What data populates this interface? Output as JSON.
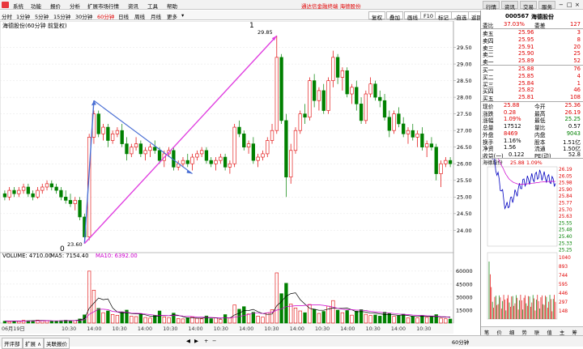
{
  "menubar": {
    "items": [
      "系统",
      "功能",
      "报价",
      "分析",
      "扩展市场行情",
      "资讯",
      "工具",
      "帮助"
    ],
    "notice": "通达信金融终端   海德股份",
    "right_buttons": [
      "行情",
      "资讯",
      "交易",
      "服务"
    ]
  },
  "periodbar": {
    "items": [
      "分时",
      "1分钟",
      "5分钟",
      "15分钟",
      "30分钟",
      "60分钟",
      "日线",
      "周线",
      "月线",
      "更多"
    ],
    "active_index": 5,
    "right_buttons": [
      "复权",
      "叠加",
      "画线",
      "F10",
      "标记",
      "-自选",
      "返回"
    ]
  },
  "chart": {
    "title": "海德股份(60分钟 前复权)",
    "volume_label": "VOLUME: 4710.00",
    "ma5_label": "MA5: 7154.40",
    "ma10_label": "MA10: 6392.00",
    "period_tag": "60分钟",
    "date_labels": [
      "06月19日",
      "10:30",
      "14:00",
      "10:30",
      "14:00",
      "10:30",
      "14:00",
      "10:30",
      "14:00",
      "10:30",
      "14:00",
      "10:30",
      "14:00",
      "10:30",
      "14:00",
      "10:30"
    ],
    "annotation_zero": "0",
    "annotation_one": "1",
    "low_price_label": "23.60",
    "high_price_label": "29.85",
    "colors": {
      "up": "#e00000",
      "down": "#008000",
      "ma5": "#000000",
      "ma10": "#cc00cc",
      "blue_line": "#4a6fd4",
      "pink_line": "#e040e0"
    }
  },
  "chart_data": {
    "type": "candlestick",
    "price_ylim": [
      23.4,
      30.0
    ],
    "price_ticks": [
      "29.50",
      "29.00",
      "28.50",
      "28.00",
      "27.50",
      "27.00",
      "26.50",
      "26.00",
      "25.50",
      "25.00",
      "24.50",
      "24.00"
    ],
    "volume_ylim": [
      0,
      72000
    ],
    "volume_ticks": [
      "60000",
      "45000",
      "30000",
      "15000"
    ],
    "candles": [
      [
        25.1,
        25.2,
        24.9,
        25.0
      ],
      [
        25.0,
        25.3,
        24.9,
        25.2
      ],
      [
        25.2,
        25.3,
        25.0,
        25.1
      ],
      [
        25.1,
        25.3,
        25.0,
        25.2
      ],
      [
        25.2,
        25.4,
        25.1,
        25.3
      ],
      [
        25.3,
        25.4,
        25.0,
        25.1
      ],
      [
        25.1,
        25.2,
        24.9,
        25.0
      ],
      [
        25.0,
        25.3,
        24.95,
        25.2
      ],
      [
        25.2,
        25.4,
        25.1,
        25.3
      ],
      [
        25.3,
        25.5,
        25.2,
        25.4
      ],
      [
        25.4,
        25.5,
        25.2,
        25.3
      ],
      [
        25.3,
        25.4,
        25.1,
        25.2
      ],
      [
        25.2,
        25.3,
        24.9,
        25.0
      ],
      [
        25.0,
        25.2,
        24.8,
        24.9
      ],
      [
        24.9,
        25.1,
        24.7,
        24.8
      ],
      [
        24.8,
        25.0,
        24.6,
        24.9
      ],
      [
        24.9,
        25.0,
        24.3,
        24.4
      ],
      [
        24.4,
        24.5,
        23.6,
        23.8
      ],
      [
        23.8,
        26.9,
        23.7,
        26.8
      ],
      [
        26.8,
        27.6,
        26.6,
        27.5
      ],
      [
        27.5,
        27.6,
        26.8,
        26.9
      ],
      [
        26.9,
        27.2,
        26.7,
        27.1
      ],
      [
        27.1,
        27.2,
        26.5,
        26.7
      ],
      [
        26.7,
        27.0,
        26.6,
        26.9
      ],
      [
        26.9,
        27.1,
        26.8,
        27.0
      ],
      [
        27.0,
        27.2,
        26.5,
        26.6
      ],
      [
        26.6,
        26.8,
        26.1,
        26.3
      ],
      [
        26.3,
        26.6,
        26.2,
        26.5
      ],
      [
        26.5,
        26.8,
        26.4,
        26.6
      ],
      [
        26.6,
        26.7,
        26.2,
        26.3
      ],
      [
        26.3,
        26.5,
        26.1,
        26.4
      ],
      [
        26.4,
        26.6,
        26.2,
        26.5
      ],
      [
        26.5,
        26.7,
        26.3,
        26.4
      ],
      [
        26.4,
        26.5,
        26.0,
        26.1
      ],
      [
        26.1,
        26.4,
        25.9,
        26.3
      ],
      [
        26.3,
        26.5,
        26.2,
        26.4
      ],
      [
        26.4,
        26.5,
        25.8,
        25.9
      ],
      [
        25.9,
        26.1,
        25.8,
        26.0
      ],
      [
        26.0,
        26.2,
        25.9,
        26.1
      ],
      [
        26.1,
        26.3,
        25.9,
        26.0
      ],
      [
        26.0,
        26.3,
        25.8,
        26.2
      ],
      [
        26.2,
        26.4,
        26.1,
        26.3
      ],
      [
        26.3,
        26.5,
        26.2,
        26.4
      ],
      [
        26.4,
        26.5,
        26.0,
        26.1
      ],
      [
        26.1,
        26.2,
        25.9,
        26.0
      ],
      [
        26.0,
        26.2,
        25.8,
        26.1
      ],
      [
        26.1,
        26.3,
        26.0,
        26.2
      ],
      [
        26.2,
        26.3,
        25.8,
        25.9
      ],
      [
        25.9,
        26.1,
        25.7,
        26.0
      ],
      [
        26.0,
        27.2,
        25.9,
        27.1
      ],
      [
        27.1,
        27.3,
        26.8,
        26.9
      ],
      [
        26.9,
        27.0,
        26.4,
        26.5
      ],
      [
        26.5,
        26.7,
        26.3,
        26.6
      ],
      [
        26.6,
        26.8,
        26.0,
        26.1
      ],
      [
        26.1,
        26.3,
        25.9,
        26.2
      ],
      [
        26.2,
        26.4,
        26.1,
        26.3
      ],
      [
        26.3,
        26.8,
        26.2,
        26.7
      ],
      [
        26.7,
        27.2,
        26.6,
        27.0
      ],
      [
        27.0,
        29.85,
        26.9,
        29.2
      ],
      [
        29.2,
        29.3,
        27.2,
        27.3
      ],
      [
        27.3,
        27.5,
        25.0,
        25.6
      ],
      [
        25.6,
        26.6,
        25.4,
        26.4
      ],
      [
        26.4,
        27.1,
        26.3,
        27.0
      ],
      [
        27.0,
        27.6,
        26.9,
        27.5
      ],
      [
        27.5,
        27.8,
        27.2,
        27.4
      ],
      [
        27.4,
        28.6,
        27.3,
        28.5
      ],
      [
        28.5,
        28.7,
        27.7,
        27.9
      ],
      [
        27.9,
        28.3,
        27.6,
        28.2
      ],
      [
        28.2,
        28.4,
        27.5,
        27.6
      ],
      [
        27.6,
        28.6,
        27.5,
        28.5
      ],
      [
        28.5,
        29.4,
        28.3,
        29.2
      ],
      [
        29.2,
        29.3,
        28.4,
        28.6
      ],
      [
        28.6,
        28.9,
        28.2,
        28.8
      ],
      [
        28.8,
        28.9,
        28.0,
        28.1
      ],
      [
        28.1,
        28.4,
        27.8,
        28.3
      ],
      [
        28.3,
        28.5,
        27.6,
        27.8
      ],
      [
        27.8,
        28.0,
        27.2,
        27.3
      ],
      [
        27.3,
        28.2,
        27.2,
        28.1
      ],
      [
        28.1,
        28.6,
        28.0,
        28.4
      ],
      [
        28.4,
        28.5,
        27.9,
        28.0
      ],
      [
        28.0,
        28.2,
        27.7,
        27.9
      ],
      [
        27.9,
        28.1,
        27.3,
        27.4
      ],
      [
        27.4,
        27.6,
        26.8,
        27.0
      ],
      [
        27.0,
        27.6,
        26.9,
        27.5
      ],
      [
        27.5,
        27.7,
        27.1,
        27.2
      ],
      [
        27.2,
        27.4,
        26.8,
        26.9
      ],
      [
        26.9,
        27.1,
        26.6,
        27.0
      ],
      [
        27.0,
        27.2,
        26.7,
        26.8
      ],
      [
        26.8,
        27.0,
        26.5,
        26.9
      ],
      [
        26.9,
        27.1,
        26.4,
        26.5
      ],
      [
        26.5,
        26.7,
        26.2,
        26.6
      ],
      [
        26.6,
        26.8,
        26.4,
        26.5
      ],
      [
        26.5,
        26.6,
        25.5,
        25.7
      ],
      [
        25.7,
        26.1,
        25.3,
        26.0
      ],
      [
        26.0,
        26.2,
        25.9,
        26.1
      ],
      [
        26.1,
        26.2,
        25.9,
        26.0
      ]
    ],
    "volumes": [
      2200,
      1800,
      2500,
      2000,
      3100,
      2700,
      2100,
      3400,
      2600,
      2900,
      2300,
      2000,
      2800,
      3300,
      2600,
      3000,
      4800,
      9500,
      60000,
      38000,
      17000,
      12000,
      14000,
      10000,
      9000,
      13000,
      15000,
      8000,
      7500,
      11000,
      6500,
      5800,
      9000,
      14000,
      7200,
      6400,
      11500,
      5200,
      4800,
      6200,
      7000,
      5500,
      4900,
      8200,
      5100,
      6000,
      4200,
      9800,
      6100,
      21000,
      16000,
      19000,
      10500,
      12500,
      8100,
      6900,
      11800,
      15500,
      58000,
      34000,
      46000,
      22000,
      17500,
      14000,
      12000,
      21500,
      15800,
      11200,
      13500,
      19500,
      26000,
      15000,
      12000,
      14500,
      9200,
      13800,
      15600,
      10200,
      8800,
      9400,
      8100,
      12600,
      11500,
      7900,
      8400,
      10300,
      6100,
      7800,
      5900,
      8900,
      6600,
      7100,
      9800,
      5600,
      5100,
      4710
    ],
    "ma5": [
      2400,
      2300,
      2200,
      2400,
      2500,
      2600,
      2800,
      3000,
      3100,
      2900,
      2600,
      2500,
      2600,
      2900,
      3000,
      3100,
      3600,
      5200,
      17000,
      23000,
      29000,
      27000,
      28000,
      17500,
      12800,
      11600,
      12200,
      11000,
      10700,
      10500,
      9500,
      8000,
      7500,
      8500,
      8800,
      8600,
      9600,
      9000,
      7400,
      6000,
      5900,
      5700,
      5600,
      6300,
      6200,
      5900,
      5400,
      6300,
      5800,
      9400,
      11400,
      14400,
      14500,
      15800,
      13200,
      11000,
      10000,
      10500,
      20000,
      25000,
      31000,
      34000,
      35000,
      27000,
      22000,
      17000,
      16000,
      14800,
      14800,
      16300,
      17400,
      17000,
      17000,
      17300,
      15300,
      12900,
      13400,
      12700,
      11500,
      11600,
      10700,
      9900,
      10000,
      9500,
      9000,
      9400,
      8800,
      7900,
      7700,
      7900,
      7700,
      7600,
      7700,
      7000,
      6900,
      7154
    ],
    "ma10": [
      2300,
      2300,
      2300,
      2300,
      2400,
      2450,
      2500,
      2600,
      2750,
      2800,
      2700,
      2650,
      2700,
      2800,
      2800,
      2850,
      3100,
      3800,
      10000,
      13000,
      16000,
      16000,
      15500,
      13500,
      13000,
      13000,
      12500,
      11500,
      11300,
      11100,
      10500,
      9800,
      9200,
      9000,
      8800,
      8600,
      8800,
      8600,
      8200,
      8000,
      7500,
      7000,
      6900,
      6600,
      6500,
      6300,
      6000,
      6000,
      5900,
      6800,
      7700,
      8800,
      10000,
      11500,
      11500,
      11000,
      12000,
      12500,
      15000,
      16500,
      19000,
      19500,
      20000,
      20000,
      20500,
      21000,
      21000,
      21000,
      20500,
      19500,
      18500,
      17000,
      16000,
      15500,
      15500,
      15000,
      15000,
      14500,
      13500,
      13000,
      12500,
      11800,
      11600,
      11000,
      10500,
      10200,
      9800,
      9300,
      9000,
      8800,
      8400,
      8200,
      8000,
      7500,
      7300,
      6392
    ]
  },
  "rightpanel": {
    "code": "000567",
    "name": "海德股份",
    "ratio": {
      "label": "委比",
      "value": "37.03%",
      "label2": "委差",
      "value2": "127"
    },
    "asks": [
      {
        "label": "卖五",
        "price": "25.96",
        "vol": "3"
      },
      {
        "label": "卖四",
        "price": "25.95",
        "vol": "8"
      },
      {
        "label": "卖三",
        "price": "25.91",
        "vol": "20"
      },
      {
        "label": "卖二",
        "price": "25.90",
        "vol": "25"
      },
      {
        "label": "卖一",
        "price": "25.89",
        "vol": "52"
      }
    ],
    "bids": [
      {
        "label": "买一",
        "price": "25.88",
        "vol": "76"
      },
      {
        "label": "买二",
        "price": "25.85",
        "vol": "4"
      },
      {
        "label": "买三",
        "price": "25.84",
        "vol": "1"
      },
      {
        "label": "买四",
        "price": "25.82",
        "vol": "46"
      },
      {
        "label": "买五",
        "price": "25.81",
        "vol": "108"
      }
    ],
    "stats": [
      {
        "l1": "现价",
        "v1": "25.88",
        "l2": "今开",
        "v2": "25.36"
      },
      {
        "l1": "涨跌",
        "v1": "0.28",
        "l2": "最高",
        "v2": "26.19"
      },
      {
        "l1": "涨幅",
        "v1": "1.09%",
        "l2": "最低",
        "v2": "25.25"
      },
      {
        "l1": "总量",
        "v1": "17512",
        "l2": "量比",
        "v2": "0.57"
      },
      {
        "l1": "外盘",
        "v1": "8469",
        "l2": "内盘",
        "v2": "9043"
      },
      {
        "l1": "换手",
        "v1": "1.16%",
        "l2": "股本",
        "v2": "1.51亿"
      },
      {
        "l1": "净资",
        "v1": "1.56",
        "l2": "流通",
        "v2": "1.50亿"
      },
      {
        "l1": "收益(一)",
        "v1": "0.122",
        "l2": "PE(动)",
        "v2": "52.8"
      }
    ],
    "mini": {
      "title": "海德股份",
      "price_label": "25.88",
      "pct_label": "1.09%",
      "right_ticks": [
        "26.19",
        "26.05",
        "25.98",
        "25.90",
        "25.84",
        "25.77",
        "25.70",
        "25.63",
        "25.55",
        "25.48",
        "25.40",
        "25.33",
        "25.25"
      ],
      "vol_ticks": [
        "1040",
        "893",
        "744",
        "595",
        "446",
        "297",
        "148"
      ]
    },
    "tabs": [
      "笔",
      "价",
      "细",
      "势",
      "联",
      "值",
      "主",
      "筹"
    ]
  },
  "bottombar": {
    "buttons": [
      "开评部",
      "扩展 ∧",
      "关联报价"
    ],
    "icons": [
      "◀",
      "▶",
      "+",
      "−"
    ],
    "tabs": [
      "主力",
      "量比",
      "指标"
    ]
  }
}
